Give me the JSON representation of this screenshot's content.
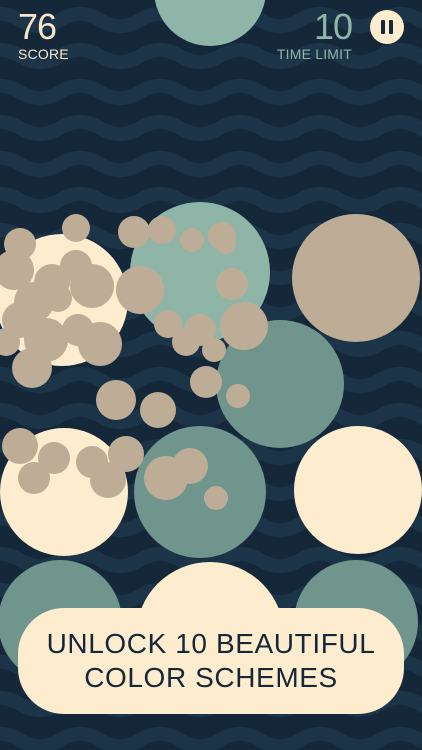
{
  "hud": {
    "score_value": "76",
    "score_label": "SCORE",
    "time_value": "10",
    "time_label": "TIME LIMIT",
    "pause_icon": "pause-icon"
  },
  "promo": {
    "line1": "UNLOCK 10 BEAUTIFUL",
    "line2": "COLOR SCHEMES"
  },
  "colors": {
    "background": "#14283a",
    "wave": "#1c3447",
    "cream": "#fdecce",
    "teal_dark": "#6f958c",
    "teal_light": "#8fb5a9",
    "tan": "#bdad96",
    "time_text": "#8fb5a9"
  }
}
